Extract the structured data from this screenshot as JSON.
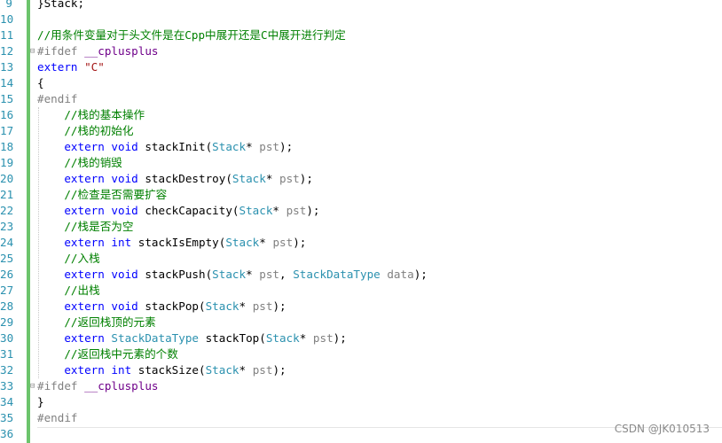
{
  "editor": {
    "lines": [
      {
        "num": "9",
        "tokens": [
          [
            "plain",
            "}Stack;"
          ]
        ]
      },
      {
        "num": "10",
        "tokens": []
      },
      {
        "num": "11",
        "tokens": [
          [
            "comment",
            "//用条件变量对于头文件是在Cpp中展开还是C中展开进行判定"
          ]
        ]
      },
      {
        "num": "12",
        "tokens": [
          [
            "prep",
            "#ifdef "
          ],
          [
            "macro",
            "__cplusplus"
          ]
        ]
      },
      {
        "num": "13",
        "tokens": [
          [
            "kw",
            "extern "
          ],
          [
            "str",
            "\"C\""
          ]
        ]
      },
      {
        "num": "14",
        "tokens": [
          [
            "plain",
            "{"
          ]
        ]
      },
      {
        "num": "15",
        "tokens": [
          [
            "prep",
            "#endif"
          ]
        ]
      },
      {
        "num": "16",
        "tokens": [
          [
            "plain",
            "    "
          ],
          [
            "comment",
            "//栈的基本操作"
          ]
        ]
      },
      {
        "num": "17",
        "tokens": [
          [
            "plain",
            "    "
          ],
          [
            "comment",
            "//栈的初始化"
          ]
        ]
      },
      {
        "num": "18",
        "tokens": [
          [
            "plain",
            "    "
          ],
          [
            "kw",
            "extern "
          ],
          [
            "kw",
            "void "
          ],
          [
            "fn",
            "stackInit("
          ],
          [
            "type",
            "Stack"
          ],
          [
            "plain",
            "* "
          ],
          [
            "param",
            "pst"
          ],
          [
            "plain",
            ");"
          ]
        ]
      },
      {
        "num": "19",
        "tokens": [
          [
            "plain",
            "    "
          ],
          [
            "comment",
            "//栈的销毁"
          ]
        ]
      },
      {
        "num": "20",
        "tokens": [
          [
            "plain",
            "    "
          ],
          [
            "kw",
            "extern "
          ],
          [
            "kw",
            "void "
          ],
          [
            "fn",
            "stackDestroy("
          ],
          [
            "type",
            "Stack"
          ],
          [
            "plain",
            "* "
          ],
          [
            "param",
            "pst"
          ],
          [
            "plain",
            ");"
          ]
        ]
      },
      {
        "num": "21",
        "tokens": [
          [
            "plain",
            "    "
          ],
          [
            "comment",
            "//检查是否需要扩容"
          ]
        ]
      },
      {
        "num": "22",
        "tokens": [
          [
            "plain",
            "    "
          ],
          [
            "kw",
            "extern "
          ],
          [
            "kw",
            "void "
          ],
          [
            "fn",
            "checkCapacity("
          ],
          [
            "type",
            "Stack"
          ],
          [
            "plain",
            "* "
          ],
          [
            "param",
            "pst"
          ],
          [
            "plain",
            ");"
          ]
        ]
      },
      {
        "num": "23",
        "tokens": [
          [
            "plain",
            "    "
          ],
          [
            "comment",
            "//栈是否为空"
          ]
        ]
      },
      {
        "num": "24",
        "tokens": [
          [
            "plain",
            "    "
          ],
          [
            "kw",
            "extern "
          ],
          [
            "kw",
            "int "
          ],
          [
            "fn",
            "stackIsEmpty("
          ],
          [
            "type",
            "Stack"
          ],
          [
            "plain",
            "* "
          ],
          [
            "param",
            "pst"
          ],
          [
            "plain",
            ");"
          ]
        ]
      },
      {
        "num": "25",
        "tokens": [
          [
            "plain",
            "    "
          ],
          [
            "comment",
            "//入栈"
          ]
        ]
      },
      {
        "num": "26",
        "tokens": [
          [
            "plain",
            "    "
          ],
          [
            "kw",
            "extern "
          ],
          [
            "kw",
            "void "
          ],
          [
            "fn",
            "stackPush("
          ],
          [
            "type",
            "Stack"
          ],
          [
            "plain",
            "* "
          ],
          [
            "param",
            "pst"
          ],
          [
            "plain",
            ", "
          ],
          [
            "type",
            "StackDataType "
          ],
          [
            "param",
            "data"
          ],
          [
            "plain",
            ");"
          ]
        ]
      },
      {
        "num": "27",
        "tokens": [
          [
            "plain",
            "    "
          ],
          [
            "comment",
            "//出栈"
          ]
        ]
      },
      {
        "num": "28",
        "tokens": [
          [
            "plain",
            "    "
          ],
          [
            "kw",
            "extern "
          ],
          [
            "kw",
            "void "
          ],
          [
            "fn",
            "stackPop("
          ],
          [
            "type",
            "Stack"
          ],
          [
            "plain",
            "* "
          ],
          [
            "param",
            "pst"
          ],
          [
            "plain",
            ");"
          ]
        ]
      },
      {
        "num": "29",
        "tokens": [
          [
            "plain",
            "    "
          ],
          [
            "comment",
            "//返回栈顶的元素"
          ]
        ]
      },
      {
        "num": "30",
        "tokens": [
          [
            "plain",
            "    "
          ],
          [
            "kw",
            "extern "
          ],
          [
            "type",
            "StackDataType "
          ],
          [
            "fn",
            "stackTop("
          ],
          [
            "type",
            "Stack"
          ],
          [
            "plain",
            "* "
          ],
          [
            "param",
            "pst"
          ],
          [
            "plain",
            ");"
          ]
        ]
      },
      {
        "num": "31",
        "tokens": [
          [
            "plain",
            "    "
          ],
          [
            "comment",
            "//返回栈中元素的个数"
          ]
        ]
      },
      {
        "num": "32",
        "tokens": [
          [
            "plain",
            "    "
          ],
          [
            "kw",
            "extern "
          ],
          [
            "kw",
            "int "
          ],
          [
            "fn",
            "stackSize("
          ],
          [
            "type",
            "Stack"
          ],
          [
            "plain",
            "* "
          ],
          [
            "param",
            "pst"
          ],
          [
            "plain",
            ");"
          ]
        ]
      },
      {
        "num": "33",
        "tokens": [
          [
            "prep",
            "#ifdef "
          ],
          [
            "macro",
            "__cplusplus"
          ]
        ]
      },
      {
        "num": "34",
        "tokens": [
          [
            "plain",
            "}"
          ]
        ]
      },
      {
        "num": "35",
        "tokens": [
          [
            "prep",
            "#endif"
          ]
        ]
      },
      {
        "num": "36",
        "tokens": []
      }
    ]
  },
  "watermark": "CSDN @JK010513"
}
